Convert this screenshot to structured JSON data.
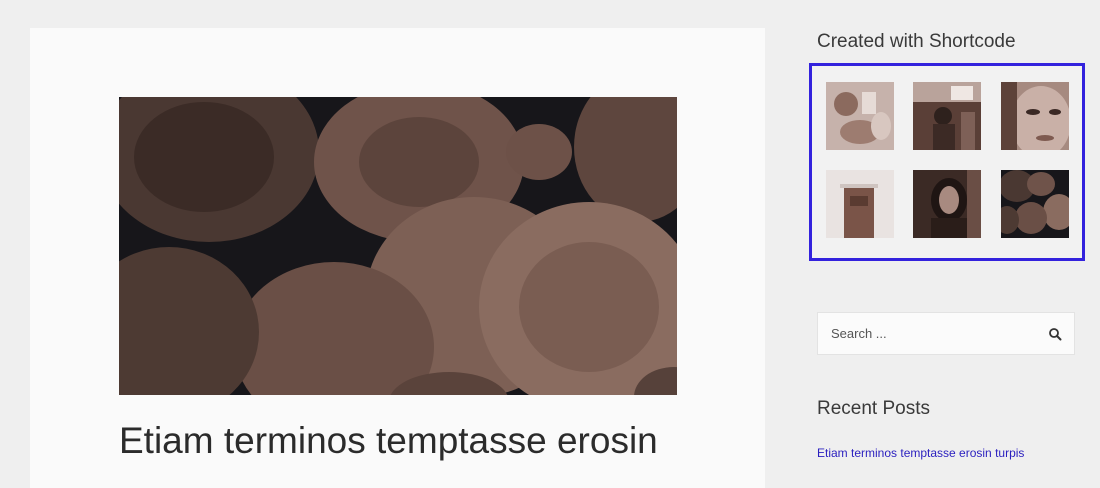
{
  "article": {
    "title": "Etiam terminos temptasse erosin",
    "featured_image": "stacked-logs-photo"
  },
  "sidebar": {
    "gallery": {
      "title": "Created with Shortcode",
      "highlight_color": "#3322dd",
      "thumbnails": [
        {
          "name": "hands-with-drinks-photo"
        },
        {
          "name": "people-in-cafe-photo"
        },
        {
          "name": "woman-face-closeup-photo"
        },
        {
          "name": "wooden-door-photo"
        },
        {
          "name": "woman-dark-hair-photo"
        },
        {
          "name": "stacked-logs-photo"
        }
      ]
    },
    "search": {
      "placeholder": "Search ...",
      "icon": "search-icon"
    },
    "recent_posts": {
      "title": "Recent Posts",
      "items": [
        "Etiam terminos temptasse erosin turpis"
      ]
    }
  },
  "colors": {
    "link": "#2a1fbf",
    "sepia_tone": "#6b4a3f"
  }
}
